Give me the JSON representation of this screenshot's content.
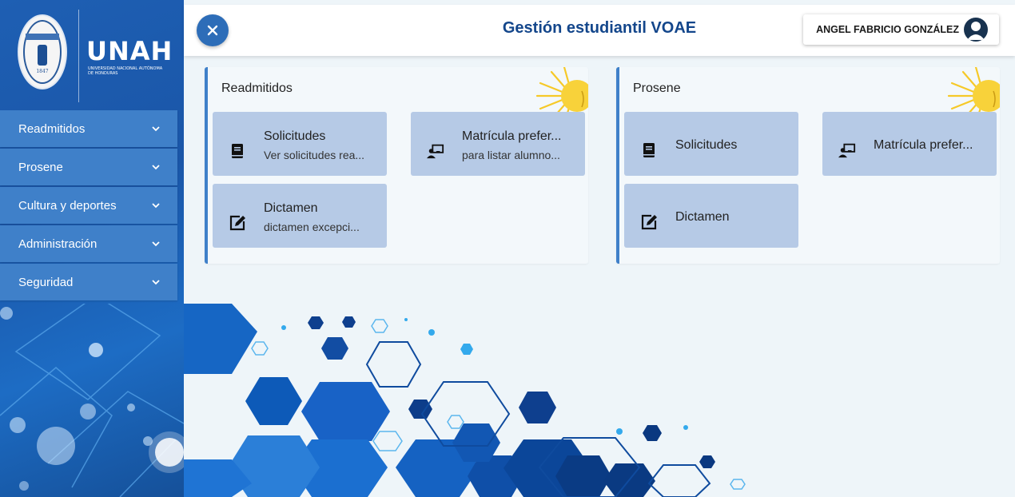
{
  "sidebar": {
    "brand": "UNAH",
    "brand_subtitle": "UNIVERSIDAD NACIONAL AUTÓNOMA DE HONDURAS",
    "seal_motto": "LUCEM ASPICIO",
    "seal_year": "1847",
    "menu": [
      {
        "label": "Readmitidos"
      },
      {
        "label": "Prosene"
      },
      {
        "label": "Cultura y deportes"
      },
      {
        "label": "Administración"
      },
      {
        "label": "Seguridad"
      }
    ]
  },
  "topbar": {
    "title": "Gestión estudiantil VOAE",
    "user_name": "ANGEL FABRICIO GONZÁLEZ"
  },
  "panels": [
    {
      "title": "Readmitidos",
      "cards": [
        {
          "title": "Solicitudes",
          "subtitle": "Ver solicitudes rea...",
          "icon": "book-icon"
        },
        {
          "title": "Matrícula prefer...",
          "subtitle": "para listar alumno...",
          "icon": "teacher-icon"
        },
        {
          "title": "Dictamen",
          "subtitle": "dictamen excepci...",
          "icon": "edit-icon"
        }
      ]
    },
    {
      "title": "Prosene",
      "cards": [
        {
          "title": "Solicitudes",
          "subtitle": "",
          "icon": "book-icon"
        },
        {
          "title": "Matrícula prefer...",
          "subtitle": "",
          "icon": "teacher-icon"
        },
        {
          "title": "Dictamen",
          "subtitle": "",
          "icon": "edit-icon"
        }
      ]
    }
  ],
  "colors": {
    "sidebar": "#1e5fb3",
    "menu_item": "#3f80c9",
    "title": "#13468b",
    "card": "#b6cae6",
    "accent": "#2d6db8"
  }
}
